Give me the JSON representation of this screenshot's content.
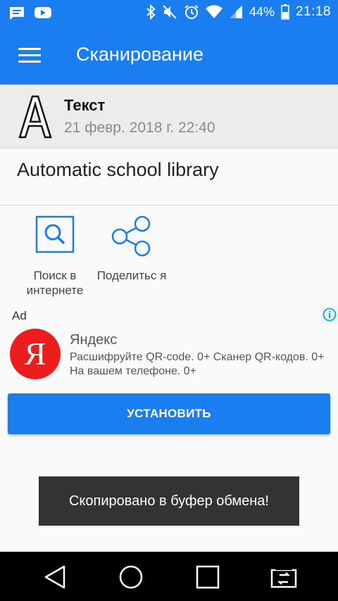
{
  "status_bar": {
    "battery_percent": "44%",
    "time": "21:18",
    "left_icons": [
      "message-icon",
      "youtube-icon"
    ],
    "right_icons": [
      "bluetooth-icon",
      "mute-icon",
      "alarm-icon",
      "wifi-icon",
      "signal-icon",
      "battery-icon"
    ]
  },
  "appbar": {
    "title": "Сканирование"
  },
  "scan": {
    "type_title": "Текст",
    "date": "21 февр. 2018 г. 22:40",
    "result_text": "Automatic school library"
  },
  "actions": {
    "search_label": "Поиск в интернете",
    "share_label": "Поделитьс я"
  },
  "ad": {
    "label": "Ad",
    "logo_letter": "Я",
    "title": "Яндекс",
    "description": "Расшифруйте QR-code. 0+ Сканер QR-кодов. 0+ На вашем телефоне. 0+",
    "install_label": "УСТАНОВИТЬ"
  },
  "toast": {
    "text": "Скопировано в буфер обмена!"
  },
  "colors": {
    "primary": "#1a7ef0",
    "yandex_red": "#ee1d1d",
    "toast_bg": "#333333"
  }
}
